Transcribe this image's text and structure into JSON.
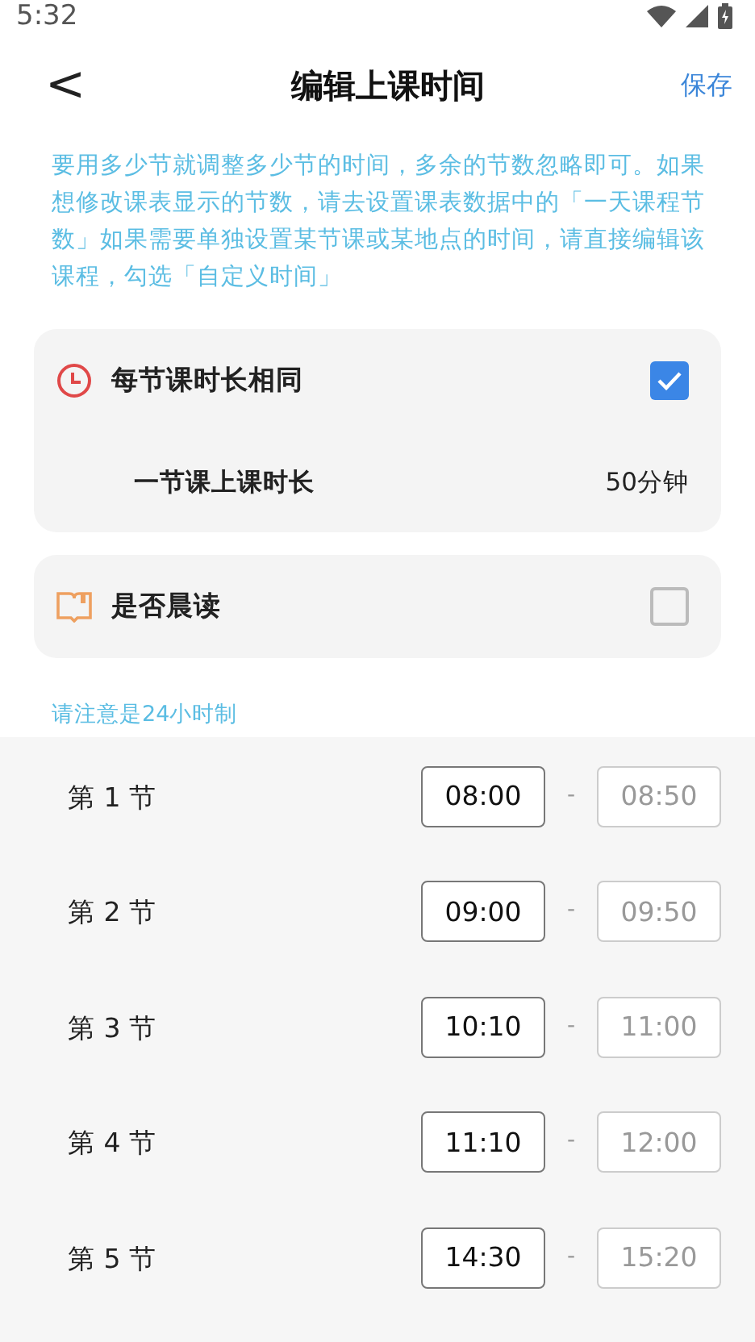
{
  "status_bar": {
    "time": "5:32"
  },
  "header": {
    "title": "编辑上课时间",
    "back": "<",
    "save": "保存"
  },
  "intro": "要用多少节就调整多少节的时间，多余的节数忽略即可。如果想修改课表显示的节数，请去设置课表数据中的「一天课程节数」如果需要单独设置某节课或某地点的时间，请直接编辑该课程，勾选「自定义时间」",
  "same_length": {
    "label": "每节课时长相同",
    "checked": true,
    "duration_label": "一节课上课时长",
    "duration_value": "50分钟"
  },
  "morning_reading": {
    "label": "是否晨读",
    "checked": false
  },
  "note": "请注意是24小时制",
  "periods": [
    {
      "label": "第 1 节",
      "start": "08:00",
      "separator": "-",
      "end": "08:50"
    },
    {
      "label": "第 2 节",
      "start": "09:00",
      "separator": "-",
      "end": "09:50"
    },
    {
      "label": "第 3 节",
      "start": "10:10",
      "separator": "-",
      "end": "11:00"
    },
    {
      "label": "第 4 节",
      "start": "11:10",
      "separator": "-",
      "end": "12:00"
    },
    {
      "label": "第 5 节",
      "start": "14:30",
      "separator": "-",
      "end": "15:20"
    }
  ]
}
